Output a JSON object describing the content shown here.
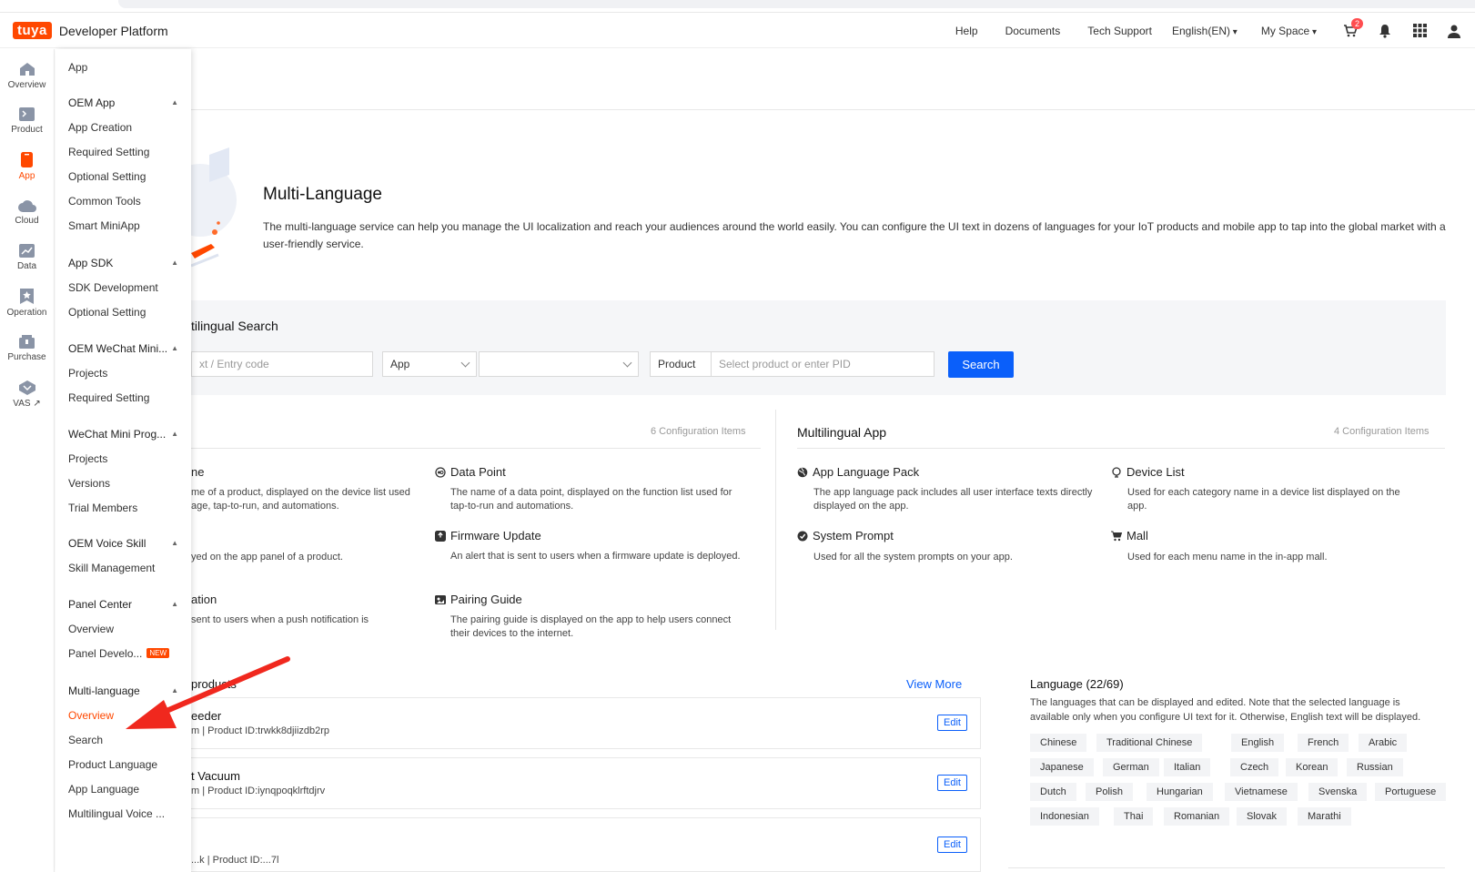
{
  "topnav": {
    "logo": "tuya",
    "brand": "Developer Platform",
    "links": [
      "Help",
      "Documents",
      "Tech Support"
    ],
    "language": "English(EN)",
    "space": "My Space",
    "cart_badge": "2"
  },
  "rail": {
    "items": [
      {
        "label": "Overview",
        "icon": "home-icon"
      },
      {
        "label": "Product",
        "icon": "product-icon"
      },
      {
        "label": "App",
        "icon": "app-icon"
      },
      {
        "label": "Cloud",
        "icon": "cloud-icon"
      },
      {
        "label": "Data",
        "icon": "data-icon"
      },
      {
        "label": "Operation",
        "icon": "operation-icon"
      },
      {
        "label": "Purchase",
        "icon": "purchase-icon"
      },
      {
        "label": "VAS",
        "icon": "vas-icon"
      }
    ],
    "active": "App"
  },
  "submenu": {
    "title": "App",
    "groups": [
      {
        "label": "OEM App",
        "items": [
          "App Creation",
          "Required Setting",
          "Optional Setting",
          "Common Tools",
          "Smart MiniApp"
        ]
      },
      {
        "label": "App SDK",
        "items": [
          "SDK Development",
          "Optional Setting"
        ]
      },
      {
        "label": "OEM WeChat Mini...",
        "items": [
          "Projects",
          "Required Setting"
        ]
      },
      {
        "label": "WeChat Mini Prog...",
        "items": [
          "Projects",
          "Versions",
          "Trial Members"
        ]
      },
      {
        "label": "OEM Voice Skill",
        "items": [
          "Skill Management"
        ]
      },
      {
        "label": "Panel Center",
        "items": [
          "Overview",
          "Panel Develo..."
        ]
      },
      {
        "label": "Multi-language",
        "items": [
          "Overview",
          "Search",
          "Product Language",
          "App Language",
          "Multilingual Voice ..."
        ]
      }
    ],
    "new_tag": "NEW",
    "active_item": "Overview"
  },
  "hero": {
    "title": "Multi-Language",
    "desc": "The multi-language service can help you manage the UI localization and reach your audiences around the world easily. You can configure the UI text in dozens of languages for your IoT products and mobile app to tap into the global market with a user-friendly service."
  },
  "search": {
    "title": "tilingual Search",
    "text_placeholder": "xt / Entry code",
    "type_value": "App",
    "product_label": "Product",
    "product_placeholder": "Select product or enter PID",
    "button": "Search"
  },
  "config": {
    "left_count": "6 Configuration Items",
    "right_title": "Multilingual App",
    "right_count": "4 Configuration Items",
    "left_items": [
      {
        "title": "ne",
        "desc": "me of a product, displayed on the device list used\nage, tap-to-run, and automations."
      },
      {
        "title": "",
        "desc": "yed on the app panel of a product."
      },
      {
        "title": "ation",
        "desc": "sent to users when a push notification is"
      }
    ],
    "mid_items": [
      {
        "title": "Data Point",
        "icon": "datapoint-icon",
        "desc": "The name of a data point, displayed on the function list used for tap-to-run and automations."
      },
      {
        "title": "Firmware Update",
        "icon": "firmware-icon",
        "desc": "An alert that is sent to users when a firmware update is deployed."
      },
      {
        "title": "Pairing Guide",
        "icon": "pairing-icon",
        "desc": "The pairing guide is displayed on the app to help users connect their devices to the internet."
      }
    ],
    "app_items": [
      {
        "title": "App Language Pack",
        "icon": "globe-icon",
        "desc": "The app language pack includes all user interface texts directly displayed on the app."
      },
      {
        "title": "Device List",
        "icon": "device-list-icon",
        "desc": "Used for each category name in a device list displayed on the app."
      },
      {
        "title": "System Prompt",
        "icon": "prompt-icon",
        "desc": "Used for all the system prompts on your app."
      },
      {
        "title": "Mall",
        "icon": "cart-icon",
        "desc": "Used for each menu name in the in-app mall."
      }
    ]
  },
  "products": {
    "title": "products",
    "view_more": "View More",
    "edit_label": "Edit",
    "items": [
      {
        "name": "eeder",
        "meta": "m  |  Product ID:trwkk8djiizdb2rp"
      },
      {
        "name": "t Vacuum",
        "meta": "m  |  Product ID:iynqpoqklrftdjrv"
      },
      {
        "name": "",
        "meta": "...k  |  Product ID:...7l"
      }
    ]
  },
  "languages": {
    "title": "Language (22/69)",
    "desc": "The languages that can be displayed and edited. Note that the selected language is available only when you configure UI text for it. Otherwise, English text will be displayed.",
    "rows": [
      [
        "Chinese",
        "Traditional Chinese",
        "English",
        "French",
        "Arabic"
      ],
      [
        "Japanese",
        "German",
        "Italian",
        "Czech",
        "Korean",
        "Russian"
      ],
      [
        "Dutch",
        "Polish",
        "Hungarian",
        "Vietnamese",
        "Svenska",
        "Portuguese"
      ],
      [
        "Indonesian",
        "Thai",
        "Romanian",
        "Slovak",
        "Marathi"
      ]
    ]
  },
  "colors": {
    "brand": "#ff4800",
    "primary": "#0a5ffa",
    "arrow": "#f0281e"
  }
}
